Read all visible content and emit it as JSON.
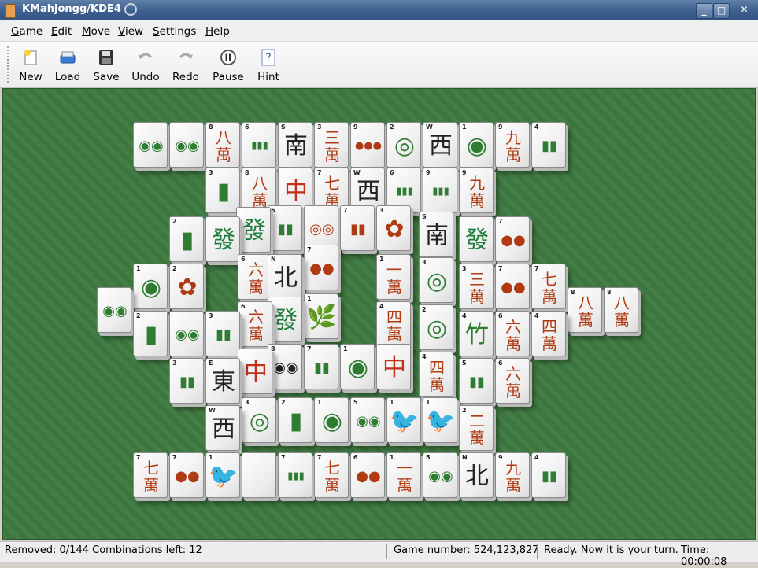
{
  "window": {
    "title": "KMahjongg/KDE4",
    "buttons": [
      "_",
      "□",
      "✕"
    ]
  },
  "menu": [
    {
      "key": "G",
      "rest": "ame"
    },
    {
      "key": "E",
      "rest": "dit"
    },
    {
      "key": "M",
      "rest": "ove"
    },
    {
      "key": "V",
      "rest": "iew"
    },
    {
      "key": "S",
      "rest": "ettings"
    },
    {
      "key": "H",
      "rest": "elp"
    }
  ],
  "toolbar": {
    "new": "New",
    "load": "Load",
    "save": "Save",
    "undo": "Undo",
    "redo": "Redo",
    "pause": "Pause",
    "hint": "Hint"
  },
  "tiles": [
    {
      "n": "",
      "f": "◉◉",
      "c": "#2e7d32"
    },
    {
      "n": "",
      "f": "◉◉",
      "c": "#2e7d32"
    },
    {
      "n": "8",
      "f": "八萬",
      "c": "#b03a12"
    },
    {
      "n": "6",
      "f": "▮▮▮",
      "c": "#2e7d32"
    },
    {
      "n": "S",
      "f": "南",
      "c": "#222"
    },
    {
      "n": "3",
      "f": "三萬",
      "c": "#b03a12"
    },
    {
      "n": "9",
      "f": "●●●",
      "c": "#b03a12"
    },
    {
      "n": "2",
      "f": "◎",
      "c": "#2e7d32"
    },
    {
      "n": "W",
      "f": "西",
      "c": "#222"
    },
    {
      "n": "1",
      "f": "◉",
      "c": "#2e7d32"
    },
    {
      "n": "9",
      "f": "九萬",
      "c": "#b03a12"
    },
    {
      "n": "4",
      "f": "▮▮",
      "c": "#2e7d32"
    },
    {
      "n": "3",
      "f": "▮",
      "c": "#2e7d32"
    },
    {
      "n": "8",
      "f": "八萬",
      "c": "#b03a12"
    },
    {
      "n": "",
      "f": "中",
      "c": "#c0301a"
    },
    {
      "n": "7",
      "f": "七萬",
      "c": "#b03a12"
    },
    {
      "n": "W",
      "f": "西",
      "c": "#222"
    },
    {
      "n": "6",
      "f": "▮▮▮",
      "c": "#2e7d32"
    },
    {
      "n": "9",
      "f": "▮▮▮",
      "c": "#2e7d32"
    },
    {
      "n": "9",
      "f": "九萬",
      "c": "#b03a12"
    },
    {
      "n": "2",
      "f": "▮",
      "c": "#2e7d32"
    },
    {
      "n": "",
      "f": "發",
      "c": "#1e7d3a"
    },
    {
      "n": "",
      "f": "發",
      "c": "#1e7d3a"
    },
    {
      "n": "6",
      "f": "▮▮",
      "c": "#2e7d32"
    },
    {
      "n": "",
      "f": "◎◎",
      "c": "#b03a12"
    },
    {
      "n": "7",
      "f": "▮▮",
      "c": "#b03a12"
    },
    {
      "n": "3",
      "f": "✿",
      "c": "#b03a12"
    },
    {
      "n": "S",
      "f": "南",
      "c": "#222"
    },
    {
      "n": "",
      "f": "發",
      "c": "#1e7d3a"
    },
    {
      "n": "7",
      "f": "●●",
      "c": "#b03a12"
    },
    {
      "n": "1",
      "f": "◉",
      "c": "#2e7d32"
    },
    {
      "n": "2",
      "f": "✿",
      "c": "#b03a12"
    },
    {
      "n": "6",
      "f": "六萬",
      "c": "#b03a12"
    },
    {
      "n": "N",
      "f": "北",
      "c": "#222"
    },
    {
      "n": "7",
      "f": "●●",
      "c": "#b03a12"
    },
    {
      "n": "1",
      "f": "一萬",
      "c": "#b03a12"
    },
    {
      "n": "3",
      "f": "◎",
      "c": "#2e7d32"
    },
    {
      "n": "3",
      "f": "三萬",
      "c": "#b03a12"
    },
    {
      "n": "7",
      "f": "●●",
      "c": "#b03a12"
    },
    {
      "n": "7",
      "f": "七萬",
      "c": "#b03a12"
    },
    {
      "n": "8",
      "f": "八萬",
      "c": "#b03a12"
    },
    {
      "n": "8",
      "f": "八萬",
      "c": "#b03a12"
    },
    {
      "n": "",
      "f": "◉◉",
      "c": "#2e7d32"
    },
    {
      "n": "2",
      "f": "▮",
      "c": "#2e7d32"
    },
    {
      "n": "",
      "f": "◉◉",
      "c": "#2e7d32"
    },
    {
      "n": "3",
      "f": "▮▮",
      "c": "#2e7d32"
    },
    {
      "n": "6",
      "f": "六萬",
      "c": "#b03a12"
    },
    {
      "n": "",
      "f": "發",
      "c": "#1e7d3a"
    },
    {
      "n": "1",
      "f": "🌿",
      "c": "#2e7d32"
    },
    {
      "n": "4",
      "f": "四萬",
      "c": "#b03a12"
    },
    {
      "n": "2",
      "f": "◎",
      "c": "#2e7d32"
    },
    {
      "n": "4",
      "f": "竹",
      "c": "#2e7d32"
    },
    {
      "n": "6",
      "f": "六萬",
      "c": "#b03a12"
    },
    {
      "n": "4",
      "f": "四萬",
      "c": "#b03a12"
    },
    {
      "n": "3",
      "f": "▮▮",
      "c": "#2e7d32"
    },
    {
      "n": "E",
      "f": "東",
      "c": "#222"
    },
    {
      "n": "",
      "f": "中",
      "c": "#c0301a"
    },
    {
      "n": "8",
      "f": "◉◉",
      "c": "#222"
    },
    {
      "n": "7",
      "f": "▮▮",
      "c": "#2e7d32"
    },
    {
      "n": "1",
      "f": "◉",
      "c": "#2e7d32"
    },
    {
      "n": "",
      "f": "中",
      "c": "#c0301a"
    },
    {
      "n": "4",
      "f": "四萬",
      "c": "#b03a12"
    },
    {
      "n": "5",
      "f": "▮▮",
      "c": "#2e7d32"
    },
    {
      "n": "6",
      "f": "六萬",
      "c": "#b03a12"
    },
    {
      "n": "W",
      "f": "西",
      "c": "#222"
    },
    {
      "n": "3",
      "f": "◎",
      "c": "#2e7d32"
    },
    {
      "n": "2",
      "f": "▮",
      "c": "#2e7d32"
    },
    {
      "n": "1",
      "f": "◉",
      "c": "#2e7d32"
    },
    {
      "n": "5",
      "f": "◉◉",
      "c": "#2e7d32"
    },
    {
      "n": "1",
      "f": "🐦",
      "c": "#2e7d32"
    },
    {
      "n": "1",
      "f": "🐦",
      "c": "#2e7d32"
    },
    {
      "n": "2",
      "f": "二萬",
      "c": "#b03a12"
    },
    {
      "n": "7",
      "f": "七萬",
      "c": "#b03a12"
    },
    {
      "n": "7",
      "f": "●●",
      "c": "#b03a12"
    },
    {
      "n": "1",
      "f": "🐦",
      "c": "#2e7d32"
    },
    {
      "n": "",
      "f": "",
      "c": "#222"
    },
    {
      "n": "7",
      "f": "▮▮▮",
      "c": "#2e7d32"
    },
    {
      "n": "7",
      "f": "七萬",
      "c": "#b03a12"
    },
    {
      "n": "6",
      "f": "●●",
      "c": "#b03a12"
    },
    {
      "n": "1",
      "f": "一萬",
      "c": "#b03a12"
    },
    {
      "n": "5",
      "f": "◉◉",
      "c": "#2e7d32"
    },
    {
      "n": "N",
      "f": "北",
      "c": "#222"
    },
    {
      "n": "9",
      "f": "九萬",
      "c": "#b03a12"
    },
    {
      "n": "4",
      "f": "▮▮",
      "c": "#2e7d32"
    }
  ],
  "status": {
    "removed": "Removed: 0/144  Combinations left: 12",
    "game": "Game number: 524,123,827",
    "message": "Ready. Now it is your turn.",
    "time": "Time: 00:00:08"
  }
}
